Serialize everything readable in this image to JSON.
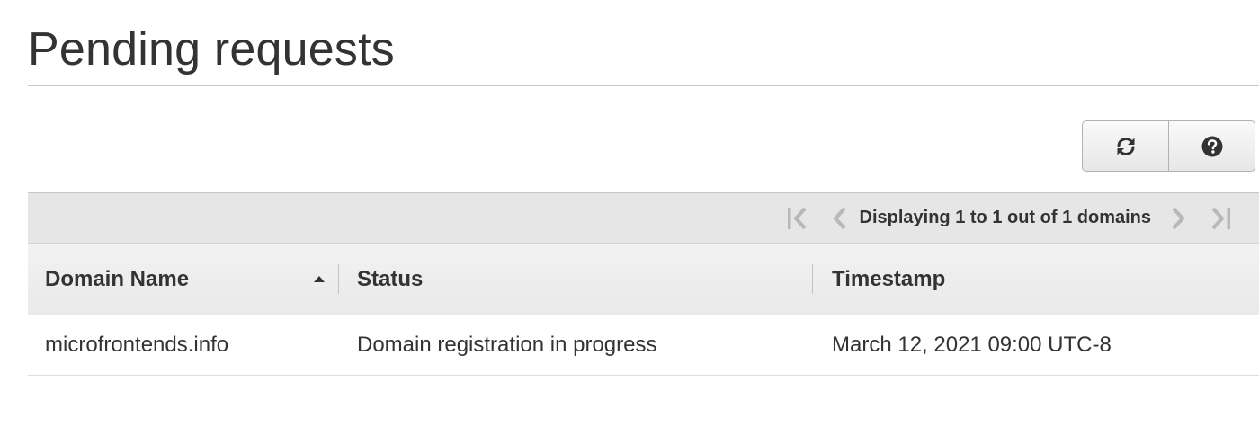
{
  "page": {
    "title": "Pending requests"
  },
  "toolbar": {
    "refresh_icon": "refresh-icon",
    "help_icon": "help-circle-icon"
  },
  "pager": {
    "text": "Displaying 1 to 1 out of 1 domains",
    "icons": [
      "first-page-icon",
      "previous-page-icon",
      "next-page-icon",
      "last-page-icon"
    ]
  },
  "table": {
    "columns": [
      "Domain Name",
      "Status",
      "Timestamp"
    ],
    "sort_icon": "sort-ascending-icon",
    "rows": [
      {
        "domain": "microfrontends.info",
        "status": "Domain registration in progress",
        "timestamp": "March 12, 2021 09:00 UTC-8"
      }
    ]
  },
  "colors": {
    "text": "#333333",
    "header_bg": "#e6e6e6",
    "disabled_icon": "#b8b8b8",
    "border": "#c8c8c8"
  }
}
